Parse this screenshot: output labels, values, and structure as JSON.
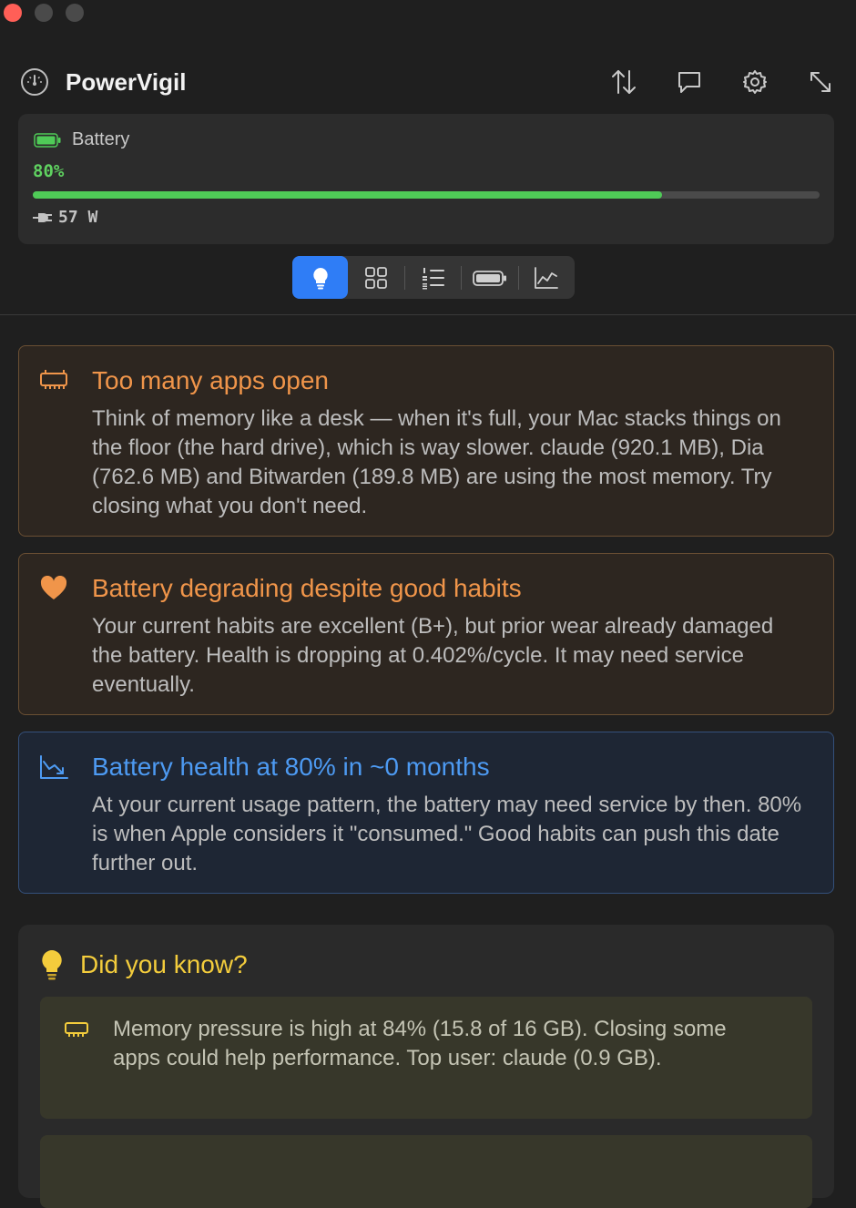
{
  "window": {
    "controls": [
      "close",
      "minimize",
      "zoom"
    ]
  },
  "header": {
    "title": "PowerVigil",
    "icon": "gauge-icon",
    "actions": [
      "sort-arrows-icon",
      "chat-bubble-icon",
      "gear-icon",
      "expand-icon"
    ]
  },
  "battery": {
    "label": "Battery",
    "percent_text": "80%",
    "level": 0.8,
    "power_text": "57 W",
    "accent": "#4fcb57"
  },
  "tabs": [
    {
      "icon": "lightbulb-icon",
      "active": true
    },
    {
      "icon": "grid-icon",
      "active": false
    },
    {
      "icon": "numbered-list-icon",
      "active": false
    },
    {
      "icon": "battery-icon",
      "active": false
    },
    {
      "icon": "line-chart-icon",
      "active": false
    }
  ],
  "tips": [
    {
      "kind": "warning",
      "icon": "memory-chip-icon",
      "title": "Too many apps open",
      "body": "Think of memory like a desk — when it's full, your Mac stacks things on the floor (the hard drive), which is way slower. claude (920.1 MB), Dia (762.6 MB) and Bitwarden (189.8 MB) are using the most memory. Try closing what you don't need."
    },
    {
      "kind": "warning",
      "icon": "heart-icon",
      "title": "Battery degrading despite good habits",
      "body": "Your current habits are excellent (B+), but prior wear already damaged the battery. Health is dropping at 0.402%/cycle. It may need service eventually."
    },
    {
      "kind": "info",
      "icon": "trend-down-chart-icon",
      "title": "Battery health at 80% in ~0 months",
      "body": "At your current usage pattern, the battery may need service by then. 80% is when Apple considers it \"consumed.\" Good habits can push this date further out."
    }
  ],
  "did_you_know": {
    "title": "Did you know?",
    "icon": "lightbulb-icon",
    "items": [
      {
        "icon": "memory-chip-icon",
        "text": "Memory pressure is high at 84% (15.8 of 16 GB). Closing some apps could help performance. Top user: claude (0.9 GB)."
      }
    ]
  },
  "colors": {
    "warning": "#f0954a",
    "info": "#4d9af2",
    "highlight": "#f3cc3c",
    "tab_active": "#2f7df6"
  }
}
